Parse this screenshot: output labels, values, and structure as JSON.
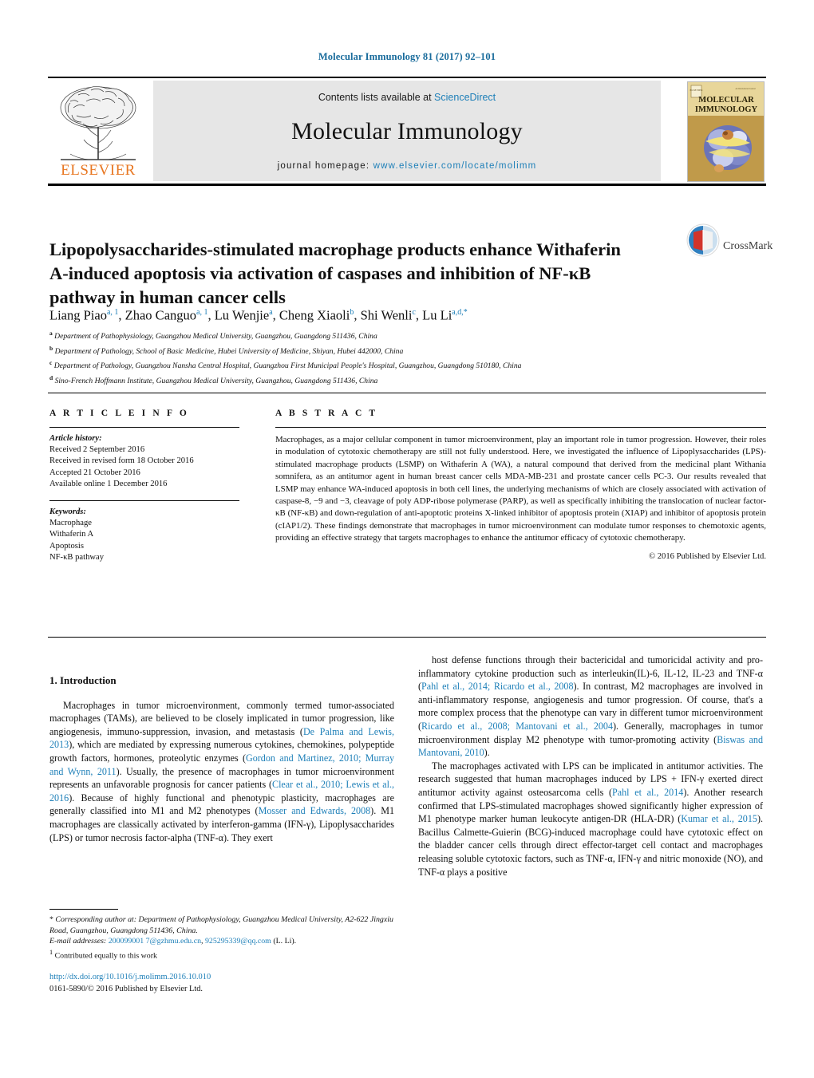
{
  "running_head": "Molecular Immunology 81 (2017) 92–101",
  "masthead": {
    "contents_prefix": "Contents lists available at ",
    "sciencedirect": "ScienceDirect",
    "journal_name": "Molecular Immunology",
    "homepage_prefix": "journal homepage: ",
    "homepage_url": "www.elsevier.com/locate/molimm",
    "publisher": "ELSEVIER",
    "cover_title_line1": "MOLECULAR",
    "cover_title_line2": "IMMUNOLOGY"
  },
  "article": {
    "title": "Lipopolysaccharides-stimulated macrophage products enhance Withaferin A-induced apoptosis via activation of caspases and inhibition of NF-κB pathway in human cancer cells",
    "crossmark_label": "CrossMark",
    "authors_html": "Liang Piao<sup>a, 1</sup>, Zhao Canguo<sup>a, 1</sup>, Lu Wenjie<sup>a</sup>, Cheng Xiaoli<sup>b</sup>, Shi Wenli<sup>c</sup>, Lu Li<sup>a,d,</sup><sup>*</sup>",
    "affiliations": [
      {
        "marker": "a",
        "text": "Department of Pathophysiology, Guangzhou Medical University, Guangzhou, Guangdong 511436, China"
      },
      {
        "marker": "b",
        "text": "Department of Pathology, School of Basic Medicine, Hubei University of Medicine, Shiyan, Hubei 442000, China"
      },
      {
        "marker": "c",
        "text": "Department of Pathology, Guangzhou Nansha Central Hospital, Guangzhou First Municipal People's Hospital, Guangzhou, Guangdong 510180, China"
      },
      {
        "marker": "d",
        "text": "Sino-French Hoffmann Institute, Guangzhou Medical University, Guangzhou, Guangdong 511436, China"
      }
    ]
  },
  "article_info": {
    "heading": "A R T I C L E   I N F O",
    "history_label": "Article history:",
    "history": [
      "Received 2 September 2016",
      "Received in revised form 18 October 2016",
      "Accepted 21 October 2016",
      "Available online 1 December 2016"
    ],
    "keywords_label": "Keywords:",
    "keywords": [
      "Macrophage",
      "Withaferin A",
      "Apoptosis",
      "NF-κB pathway"
    ]
  },
  "abstract": {
    "heading": "A B S T R A C T",
    "text": "Macrophages, as a major cellular component in tumor microenvironment, play an important role in tumor progression. However, their roles in modulation of cytotoxic chemotherapy are still not fully understood. Here, we investigated the influence of Lipoplysaccharides (LPS)-stimulated macrophage products (LSMP) on Withaferin A (WA), a natural compound that derived from the medicinal plant Withania somnifera, as an antitumor agent in human breast cancer cells MDA-MB-231 and prostate cancer cells PC-3. Our results revealed that LSMP may enhance WA-induced apoptosis in both cell lines, the underlying mechanisms of which are closely associated with activation of caspase-8, −9 and −3, cleavage of poly ADP-ribose polymerase (PARP), as well as specifically inhibiting the translocation of nuclear factor-κB (NF-κB) and down-regulation of anti-apoptotic proteins X-linked inhibitor of apoptosis protein (XIAP) and inhibitor of apoptosis protein (cIAP1/2). These findings demonstrate that macrophages in tumor microenvironment can modulate tumor responses to chemotoxic agents, providing an effective strategy that targets macrophages to enhance the antitumor efficacy of cytotoxic chemotherapy.",
    "copyright": "© 2016 Published by Elsevier Ltd."
  },
  "introduction": {
    "heading": "1. Introduction",
    "left_paragraph_html": "Macrophages in tumor microenvironment, commonly termed tumor-associated macrophages (TAMs), are believed to be closely implicated in tumor progression, like angiogenesis, immuno-suppression, invasion, and metastasis (<span class=\"ref\">De Palma and Lewis, 2013</span>), which are mediated by expressing numerous cytokines, chemokines, polypeptide growth factors, hormones, proteolytic enzymes (<span class=\"ref\">Gordon and Martinez, 2010; Murray and Wynn, 2011</span>). Usually, the presence of macrophages in tumor microenvironment represents an unfavorable prognosis for cancer patients (<span class=\"ref\">Clear et al., 2010; Lewis et al., 2016</span>). Because of highly functional and phenotypic plasticity, macrophages are generally classified into M1 and M2 phenotypes (<span class=\"ref\">Mosser and Edwards, 2008</span>). M1 macrophages are classically activated by interferon-gamma (IFN-γ), Lipoplysaccharides (LPS) or tumor necrosis factor-alpha (TNF-α). They exert",
    "right_paragraph1_html": "host defense functions through their bactericidal and tumoricidal activity and pro-inflammatory cytokine production such as interleukin(IL)-6, IL-12, IL-23 and TNF-α (<span class=\"ref\">Pahl et al., 2014; Ricardo et al., 2008</span>). In contrast, M2 macrophages are involved in anti-inflammatory response, angiogenesis and tumor progression. Of course, that's a more complex process that the phenotype can vary in different tumor microenvironment (<span class=\"ref\">Ricardo et al., 2008; Mantovani et al., 2004</span>). Generally, macrophages in tumor microenvironment display M2 phenotype with tumor-promoting activity (<span class=\"ref\">Biswas and Mantovani, 2010</span>).",
    "right_paragraph2_html": "The macrophages activated with LPS can be implicated in antitumor activities. The research suggested that human macrophages induced by LPS + IFN-γ exerted direct antitumor activity against osteosarcoma cells (<span class=\"ref\">Pahl et al., 2014</span>). Another research confirmed that LPS-stimulated macrophages showed significantly higher expression of M1 phenotype marker human leukocyte antigen-DR (HLA-DR) (<span class=\"ref\">Kumar et al., 2015</span>). Bacillus Calmette-Guierin (BCG)-induced macrophage could have cytotoxic effect on the bladder cancer cells through direct effector-target cell contact and macrophages releasing soluble cytotoxic factors, such as TNF-α, IFN-γ and nitric monoxide (NO), and TNF-α plays a positive"
  },
  "footnotes": {
    "corresponding_html": "<span class=\"star\">*</span> <span class=\"fn-ital\">Corresponding author at: Department of Pathophysiology, Guangzhou Medical University, A2-622 Jingxiu Road, Guangzhou, Guangdong 511436, China.</span>",
    "email_html": "<span class=\"fn-ital\">E-mail addresses:</span> <span class=\"link\">200099001 7@gzhmu.edu.cn</span>, <span class=\"link\">925295339@qq.com</span> (L. Li).",
    "equal_contribution_html": "<sup>1</sup> Contributed equally to this work",
    "doi": "http://dx.doi.org/10.1016/j.molimm.2016.10.010",
    "issn_line": "0161-5890/© 2016 Published by Elsevier Ltd."
  },
  "colors": {
    "link_blue": "#1d7fb8",
    "running_head_blue": "#1a6c9c",
    "elsevier_orange": "#E87722",
    "band_grey": "#e6e6e6"
  }
}
